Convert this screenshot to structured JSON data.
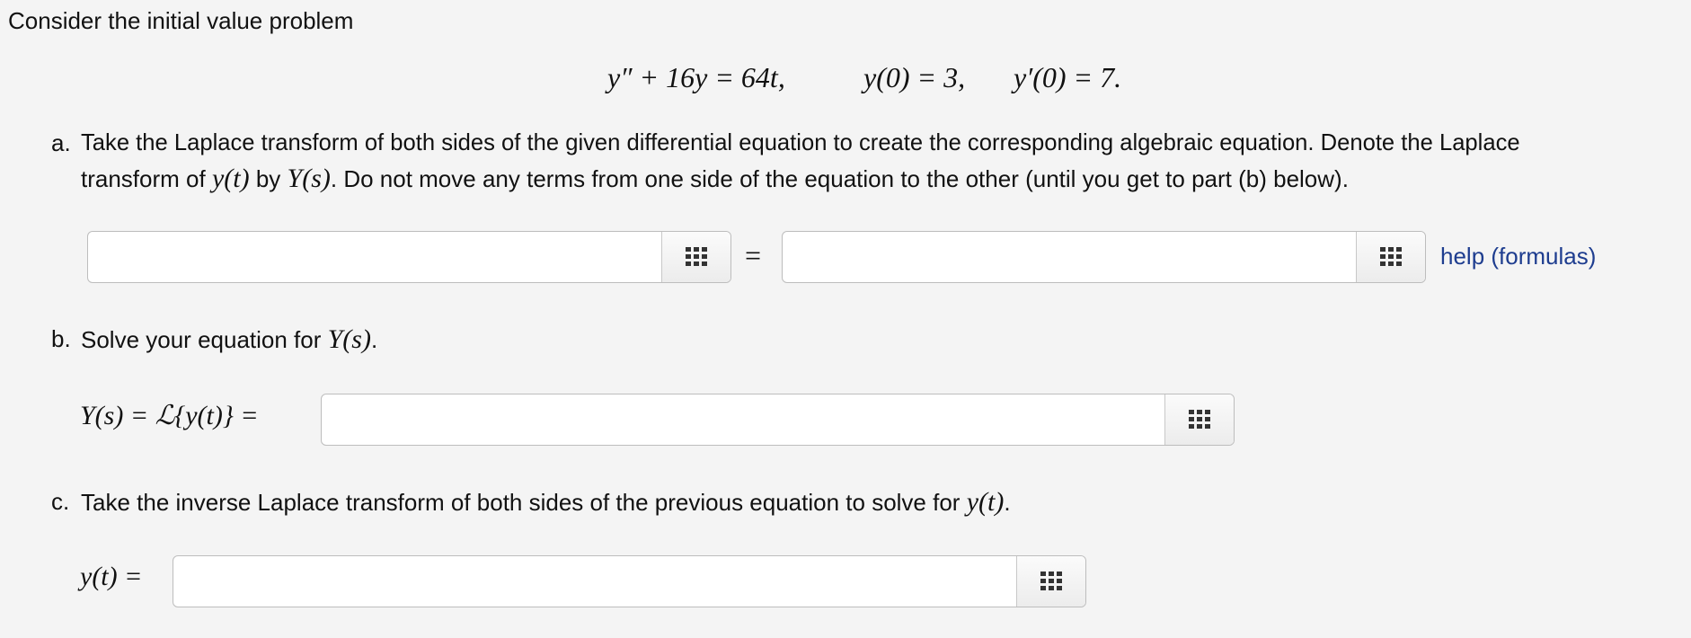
{
  "intro": "Consider the initial value problem",
  "ode": {
    "lhs": "y″ + 16y = 64t,",
    "ic1": "y(0) = 3,",
    "ic2": "y′(0) = 7."
  },
  "part_a": {
    "marker": "a.",
    "line1": "Take the Laplace transform of both sides of the given differential equation to create the corresponding algebraic equation. Denote the Laplace",
    "line2_pre": "transform of",
    "line2_y": "y(t)",
    "line2_by": "by",
    "line2_Y": "Y(s)",
    "line2_post": ". Do not move any terms from one side of the equation to the other (until you get to part (b) below).",
    "equals": "=",
    "left_value": "",
    "right_value": "",
    "help_link": "help (formulas)"
  },
  "part_b": {
    "marker": "b.",
    "text": "Solve your equation for",
    "var": "Y(s)",
    "period": ".",
    "prefix": "Y(s) = ℒ{y(t)} =",
    "value": ""
  },
  "part_c": {
    "marker": "c.",
    "text": "Take the inverse Laplace transform of both sides of the previous equation to solve for",
    "var": "y(t)",
    "period": ".",
    "prefix": "y(t) =",
    "value": ""
  },
  "icons": {
    "equation_editor": "grid-icon"
  }
}
